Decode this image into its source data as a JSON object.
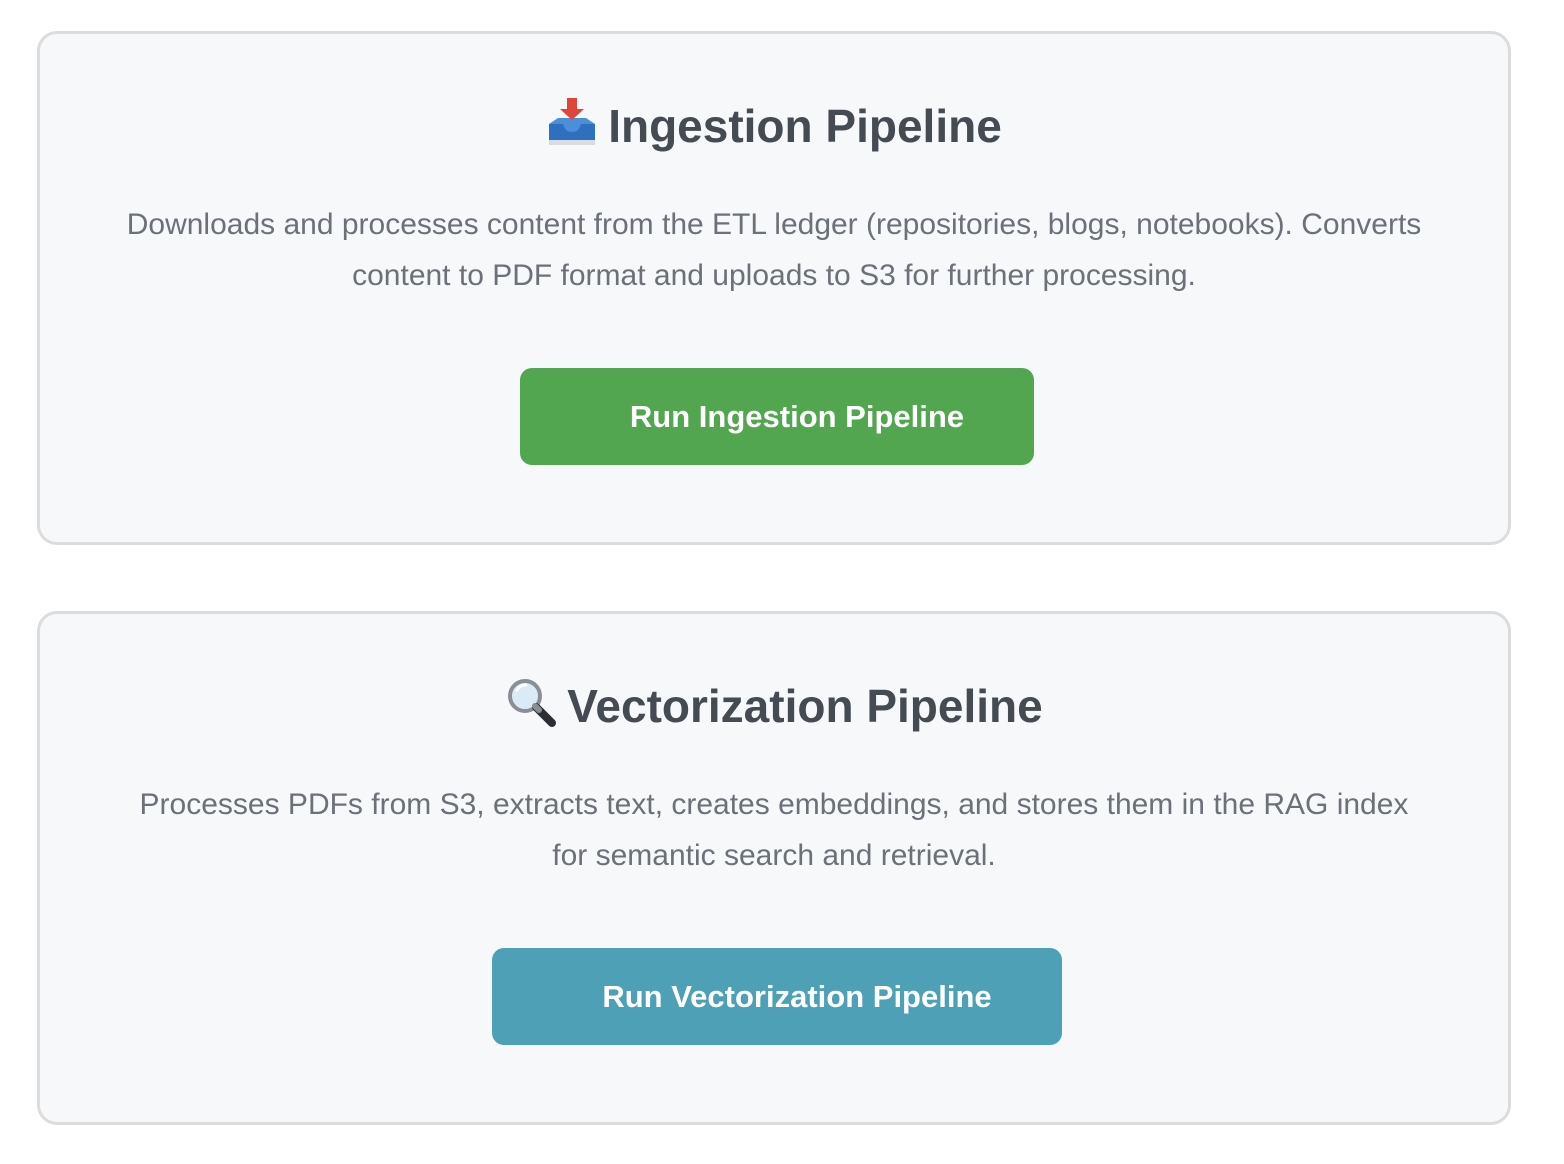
{
  "pipelines": [
    {
      "icon": "inbox-tray-icon",
      "title": "Ingestion Pipeline",
      "description": "Downloads and processes content from the ETL ledger (repositories, blogs, notebooks). Converts content to PDF format and uploads to S3 for further processing.",
      "button_label": "Run Ingestion Pipeline",
      "button_color": "#52a650"
    },
    {
      "icon": "magnifying-glass-icon",
      "title": "Vectorization Pipeline",
      "description": "Processes PDFs from S3, extracts text, creates embeddings, and stores them in the RAG index for semantic search and retrieval.",
      "button_label": "Run Vectorization Pipeline",
      "button_color": "#4da0b5"
    }
  ]
}
